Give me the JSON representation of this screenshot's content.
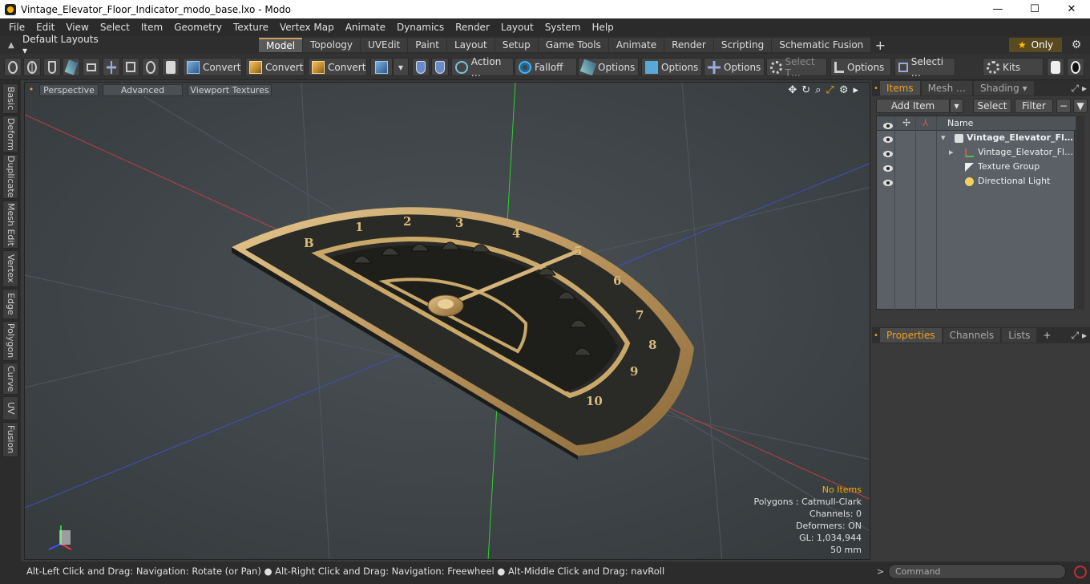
{
  "window": {
    "title": "Vintage_Elevator_Floor_Indicator_modo_base.lxo - Modo",
    "minimize": "—",
    "maximize": "☐",
    "close": "✕"
  },
  "menubar": {
    "items": [
      "File",
      "Edit",
      "View",
      "Select",
      "Item",
      "Geometry",
      "Texture",
      "Vertex Map",
      "Animate",
      "Dynamics",
      "Render",
      "Layout",
      "System",
      "Help"
    ]
  },
  "layoutrow": {
    "layouts_label": "Default Layouts ▾",
    "tabs": [
      "Model",
      "Topology",
      "UVEdit",
      "Paint",
      "Layout",
      "Setup",
      "Game Tools",
      "Animate",
      "Render",
      "Scripting",
      "Schematic Fusion"
    ],
    "active_tab": "Model",
    "plus": "+",
    "only_label": "Only",
    "star": "★",
    "gear": "⚙"
  },
  "toolbar": {
    "convert1": "Convert",
    "convert2": "Convert",
    "convert3": "Convert",
    "dropdown": "▾",
    "action": "Action …",
    "falloff": "Falloff",
    "options1": "Options",
    "options2": "Options",
    "options3": "Options",
    "select_t": "Select T…",
    "options4": "Options",
    "selecti": "Selecti …",
    "kits": "Kits"
  },
  "lefttabs": [
    "Basic",
    "Deform",
    "Duplicate",
    "Mesh Edit",
    "Vertex",
    "Edge",
    "Polygon",
    "Curve",
    "UV",
    "Fusion"
  ],
  "viewport": {
    "perspective": "Perspective",
    "advanced": "Advanced",
    "textures": "Viewport Textures",
    "icons": [
      "✥",
      "↻",
      "⌕",
      "⤢",
      "⚙",
      "▸"
    ],
    "info": {
      "no_items": "No Items",
      "polygons": "Polygons : Catmull-Clark",
      "channels": "Channels: 0",
      "deformers": "Deformers: ON",
      "gl": "GL: 1,034,944",
      "scale": "50 mm"
    },
    "dial_numbers": [
      "B",
      "1",
      "2",
      "3",
      "4",
      "5",
      "6",
      "7",
      "8",
      "9",
      "10"
    ],
    "colors": {
      "background": "#3f4549",
      "dial_dark": "#2a2a26",
      "brass": "#c9a86a",
      "axis_red": "#c04040",
      "axis_green": "#30d030",
      "axis_blue": "#4050c0"
    }
  },
  "items_panel": {
    "tabs": [
      "Items",
      "Mesh …",
      "Shading"
    ],
    "active_tab": "Items",
    "shading_arrow": "▾",
    "add_item": "Add Item",
    "add_item_arrow": "▾",
    "select": "Select",
    "filter": "Filter",
    "name_header": "Name",
    "rows": [
      {
        "label": "Vintage_Elevator_Flo…",
        "bold": true,
        "expander": "▾"
      },
      {
        "label": "Vintage_Elevator_Floo…",
        "bold": false,
        "expander": "▸"
      },
      {
        "label": "Texture Group",
        "bold": false,
        "expander": ""
      },
      {
        "label": "Directional Light",
        "bold": false,
        "expander": ""
      }
    ]
  },
  "properties_panel": {
    "tabs": [
      "Properties",
      "Channels",
      "Lists"
    ],
    "active_tab": "Properties",
    "plus": "+"
  },
  "statusbar": {
    "text": "Alt-Left Click and Drag: Navigation: Rotate (or Pan) ● Alt-Right Click and Drag: Navigation: Freewheel ● Alt-Middle Click and Drag: navRoll"
  },
  "command": {
    "arrow": ">",
    "placeholder": "Command"
  }
}
